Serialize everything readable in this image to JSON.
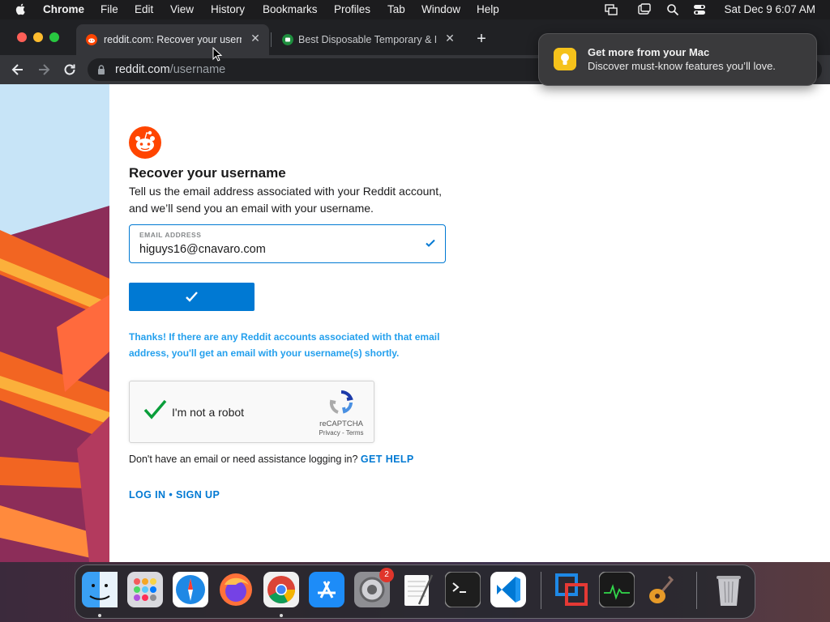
{
  "menubar": {
    "app": "Chrome",
    "items": [
      "File",
      "Edit",
      "View",
      "History",
      "Bookmarks",
      "Profiles",
      "Tab",
      "Window",
      "Help"
    ],
    "clock": "Sat Dec 9  6:07 AM"
  },
  "tabs": [
    {
      "title": "reddit.com: Recover your username",
      "active": true,
      "favicon": "reddit-icon"
    },
    {
      "title": "Best Disposable Temporary & Fake Email",
      "active": false,
      "favicon": "green-circle-icon"
    }
  ],
  "address_bar": {
    "domain": "reddit.com",
    "path": "/username"
  },
  "notification": {
    "title": "Get more from your Mac",
    "body": "Discover must-know features you’ll love."
  },
  "page": {
    "heading": "Recover your username",
    "description": "Tell us the email address associated with your Reddit account, and we’ll send you an email with your username.",
    "email_label": "EMAIL ADDRESS",
    "email_value": "higuys16@cnavaro.com",
    "thanks_message": "Thanks! If there are any Reddit accounts associated with that email address, you'll get an email with your username(s) shortly.",
    "captcha": {
      "label": "I'm not a robot",
      "brand": "reCAPTCHA",
      "links": "Privacy - Terms"
    },
    "help_text": "Don't have an email or need assistance logging in?",
    "help_link": "GET HELP",
    "login_link": "LOG IN",
    "separator": "•",
    "signup_link": "SIGN UP"
  },
  "dock": {
    "apps": [
      "finder",
      "launchpad",
      "safari",
      "firefox",
      "chrome",
      "app-store",
      "system-preferences",
      "textedit",
      "terminal",
      "vscode",
      "parallels",
      "activity-monitor",
      "garageband",
      "trash"
    ],
    "system_preferences_badge": "2"
  },
  "colors": {
    "accent": "#0079d3",
    "info_text": "#24a0ed",
    "reddit_orange": "#ff4500"
  }
}
